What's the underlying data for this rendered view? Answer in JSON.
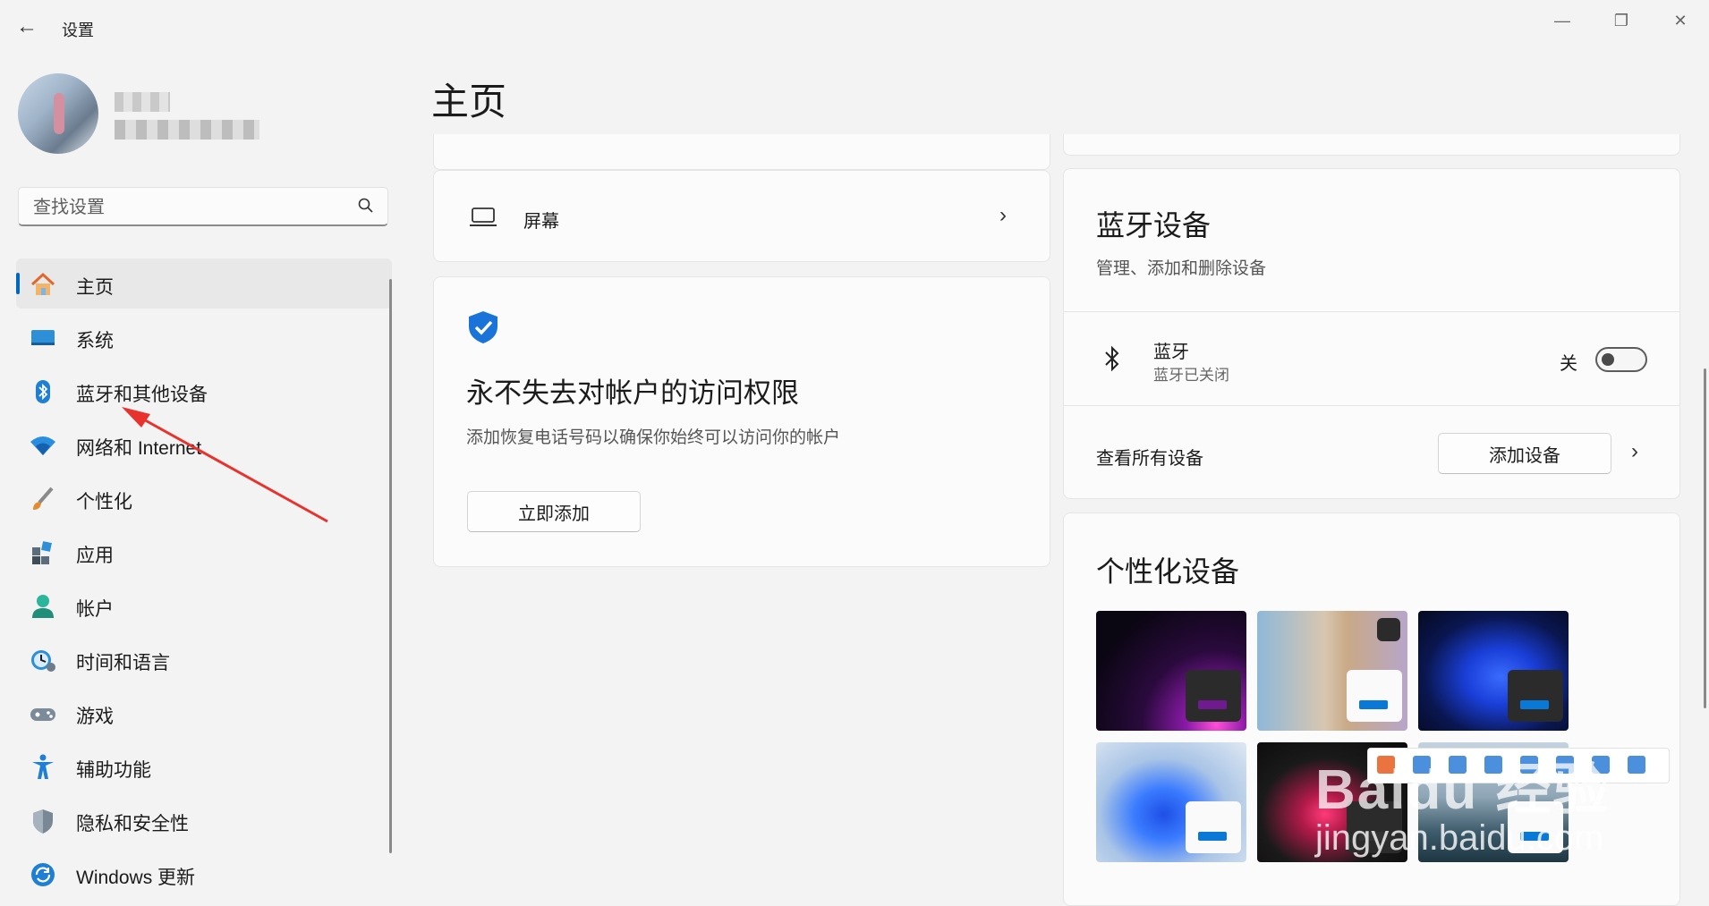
{
  "window": {
    "title": "设置",
    "controls": {
      "minimize": "—",
      "maximize": "❐",
      "close": "✕"
    }
  },
  "search": {
    "placeholder": "查找设置"
  },
  "sidebar": {
    "items": [
      {
        "label": "主页",
        "icon": "home-icon",
        "selected": true
      },
      {
        "label": "系统",
        "icon": "system-icon"
      },
      {
        "label": "蓝牙和其他设备",
        "icon": "bluetooth-icon"
      },
      {
        "label": "网络和 Internet",
        "icon": "wifi-icon"
      },
      {
        "label": "个性化",
        "icon": "brush-icon"
      },
      {
        "label": "应用",
        "icon": "apps-icon"
      },
      {
        "label": "帐户",
        "icon": "account-icon"
      },
      {
        "label": "时间和语言",
        "icon": "clock-icon"
      },
      {
        "label": "游戏",
        "icon": "gamepad-icon"
      },
      {
        "label": "辅助功能",
        "icon": "accessibility-icon"
      },
      {
        "label": "隐私和安全性",
        "icon": "shield-icon"
      },
      {
        "label": "Windows 更新",
        "icon": "update-icon"
      }
    ]
  },
  "main": {
    "title": "主页",
    "screen_row": {
      "label": "屏幕",
      "icon": "laptop-icon"
    },
    "account_card": {
      "title": "永不失去对帐户的访问权限",
      "desc": "添加恢复电话号码以确保你始终可以访问你的帐户",
      "button": "立即添加"
    },
    "bluetooth_card": {
      "title": "蓝牙设备",
      "desc": "管理、添加和删除设备",
      "bt_label": "蓝牙",
      "bt_status": "蓝牙已关闭",
      "toggle_label": "关",
      "toggle_on": false,
      "view_all": "查看所有设备",
      "add_button": "添加设备"
    },
    "personalize_card": {
      "title": "个性化设备",
      "themes": [
        {
          "name": "theme-purple-glow",
          "accent": "#6f1a8f"
        },
        {
          "name": "theme-flowers",
          "accent": "#0a78d7"
        },
        {
          "name": "theme-blue-bloom-dark",
          "accent": "#0a78d7"
        },
        {
          "name": "theme-blue-bloom-light",
          "accent": "#0a78d7"
        },
        {
          "name": "theme-captured-motion",
          "accent": "#333333"
        },
        {
          "name": "theme-sunrise",
          "accent": "#0a78d7"
        }
      ]
    }
  },
  "watermark": {
    "brand": "Baidu 经验",
    "url": "jingyan.baidu.com"
  },
  "colors": {
    "accent": "#0067c0",
    "background": "#f3f3f3",
    "card": "#fbfbfb"
  }
}
